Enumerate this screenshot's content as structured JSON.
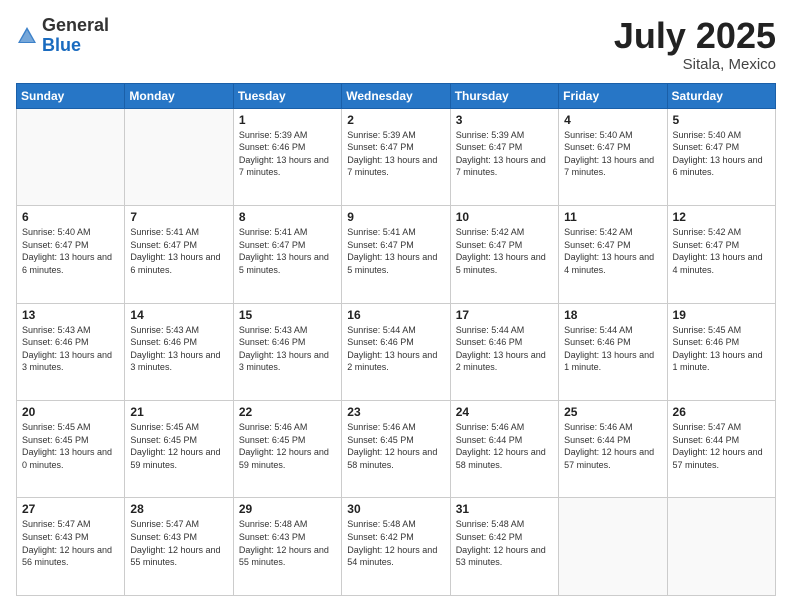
{
  "header": {
    "logo_general": "General",
    "logo_blue": "Blue",
    "title": "July 2025",
    "location": "Sitala, Mexico"
  },
  "days_of_week": [
    "Sunday",
    "Monday",
    "Tuesday",
    "Wednesday",
    "Thursday",
    "Friday",
    "Saturday"
  ],
  "weeks": [
    [
      {
        "day": "",
        "sunrise": "",
        "sunset": "",
        "daylight": ""
      },
      {
        "day": "",
        "sunrise": "",
        "sunset": "",
        "daylight": ""
      },
      {
        "day": "1",
        "sunrise": "Sunrise: 5:39 AM",
        "sunset": "Sunset: 6:46 PM",
        "daylight": "Daylight: 13 hours and 7 minutes."
      },
      {
        "day": "2",
        "sunrise": "Sunrise: 5:39 AM",
        "sunset": "Sunset: 6:47 PM",
        "daylight": "Daylight: 13 hours and 7 minutes."
      },
      {
        "day": "3",
        "sunrise": "Sunrise: 5:39 AM",
        "sunset": "Sunset: 6:47 PM",
        "daylight": "Daylight: 13 hours and 7 minutes."
      },
      {
        "day": "4",
        "sunrise": "Sunrise: 5:40 AM",
        "sunset": "Sunset: 6:47 PM",
        "daylight": "Daylight: 13 hours and 7 minutes."
      },
      {
        "day": "5",
        "sunrise": "Sunrise: 5:40 AM",
        "sunset": "Sunset: 6:47 PM",
        "daylight": "Daylight: 13 hours and 6 minutes."
      }
    ],
    [
      {
        "day": "6",
        "sunrise": "Sunrise: 5:40 AM",
        "sunset": "Sunset: 6:47 PM",
        "daylight": "Daylight: 13 hours and 6 minutes."
      },
      {
        "day": "7",
        "sunrise": "Sunrise: 5:41 AM",
        "sunset": "Sunset: 6:47 PM",
        "daylight": "Daylight: 13 hours and 6 minutes."
      },
      {
        "day": "8",
        "sunrise": "Sunrise: 5:41 AM",
        "sunset": "Sunset: 6:47 PM",
        "daylight": "Daylight: 13 hours and 5 minutes."
      },
      {
        "day": "9",
        "sunrise": "Sunrise: 5:41 AM",
        "sunset": "Sunset: 6:47 PM",
        "daylight": "Daylight: 13 hours and 5 minutes."
      },
      {
        "day": "10",
        "sunrise": "Sunrise: 5:42 AM",
        "sunset": "Sunset: 6:47 PM",
        "daylight": "Daylight: 13 hours and 5 minutes."
      },
      {
        "day": "11",
        "sunrise": "Sunrise: 5:42 AM",
        "sunset": "Sunset: 6:47 PM",
        "daylight": "Daylight: 13 hours and 4 minutes."
      },
      {
        "day": "12",
        "sunrise": "Sunrise: 5:42 AM",
        "sunset": "Sunset: 6:47 PM",
        "daylight": "Daylight: 13 hours and 4 minutes."
      }
    ],
    [
      {
        "day": "13",
        "sunrise": "Sunrise: 5:43 AM",
        "sunset": "Sunset: 6:46 PM",
        "daylight": "Daylight: 13 hours and 3 minutes."
      },
      {
        "day": "14",
        "sunrise": "Sunrise: 5:43 AM",
        "sunset": "Sunset: 6:46 PM",
        "daylight": "Daylight: 13 hours and 3 minutes."
      },
      {
        "day": "15",
        "sunrise": "Sunrise: 5:43 AM",
        "sunset": "Sunset: 6:46 PM",
        "daylight": "Daylight: 13 hours and 3 minutes."
      },
      {
        "day": "16",
        "sunrise": "Sunrise: 5:44 AM",
        "sunset": "Sunset: 6:46 PM",
        "daylight": "Daylight: 13 hours and 2 minutes."
      },
      {
        "day": "17",
        "sunrise": "Sunrise: 5:44 AM",
        "sunset": "Sunset: 6:46 PM",
        "daylight": "Daylight: 13 hours and 2 minutes."
      },
      {
        "day": "18",
        "sunrise": "Sunrise: 5:44 AM",
        "sunset": "Sunset: 6:46 PM",
        "daylight": "Daylight: 13 hours and 1 minute."
      },
      {
        "day": "19",
        "sunrise": "Sunrise: 5:45 AM",
        "sunset": "Sunset: 6:46 PM",
        "daylight": "Daylight: 13 hours and 1 minute."
      }
    ],
    [
      {
        "day": "20",
        "sunrise": "Sunrise: 5:45 AM",
        "sunset": "Sunset: 6:45 PM",
        "daylight": "Daylight: 13 hours and 0 minutes."
      },
      {
        "day": "21",
        "sunrise": "Sunrise: 5:45 AM",
        "sunset": "Sunset: 6:45 PM",
        "daylight": "Daylight: 12 hours and 59 minutes."
      },
      {
        "day": "22",
        "sunrise": "Sunrise: 5:46 AM",
        "sunset": "Sunset: 6:45 PM",
        "daylight": "Daylight: 12 hours and 59 minutes."
      },
      {
        "day": "23",
        "sunrise": "Sunrise: 5:46 AM",
        "sunset": "Sunset: 6:45 PM",
        "daylight": "Daylight: 12 hours and 58 minutes."
      },
      {
        "day": "24",
        "sunrise": "Sunrise: 5:46 AM",
        "sunset": "Sunset: 6:44 PM",
        "daylight": "Daylight: 12 hours and 58 minutes."
      },
      {
        "day": "25",
        "sunrise": "Sunrise: 5:46 AM",
        "sunset": "Sunset: 6:44 PM",
        "daylight": "Daylight: 12 hours and 57 minutes."
      },
      {
        "day": "26",
        "sunrise": "Sunrise: 5:47 AM",
        "sunset": "Sunset: 6:44 PM",
        "daylight": "Daylight: 12 hours and 57 minutes."
      }
    ],
    [
      {
        "day": "27",
        "sunrise": "Sunrise: 5:47 AM",
        "sunset": "Sunset: 6:43 PM",
        "daylight": "Daylight: 12 hours and 56 minutes."
      },
      {
        "day": "28",
        "sunrise": "Sunrise: 5:47 AM",
        "sunset": "Sunset: 6:43 PM",
        "daylight": "Daylight: 12 hours and 55 minutes."
      },
      {
        "day": "29",
        "sunrise": "Sunrise: 5:48 AM",
        "sunset": "Sunset: 6:43 PM",
        "daylight": "Daylight: 12 hours and 55 minutes."
      },
      {
        "day": "30",
        "sunrise": "Sunrise: 5:48 AM",
        "sunset": "Sunset: 6:42 PM",
        "daylight": "Daylight: 12 hours and 54 minutes."
      },
      {
        "day": "31",
        "sunrise": "Sunrise: 5:48 AM",
        "sunset": "Sunset: 6:42 PM",
        "daylight": "Daylight: 12 hours and 53 minutes."
      },
      {
        "day": "",
        "sunrise": "",
        "sunset": "",
        "daylight": ""
      },
      {
        "day": "",
        "sunrise": "",
        "sunset": "",
        "daylight": ""
      }
    ]
  ]
}
